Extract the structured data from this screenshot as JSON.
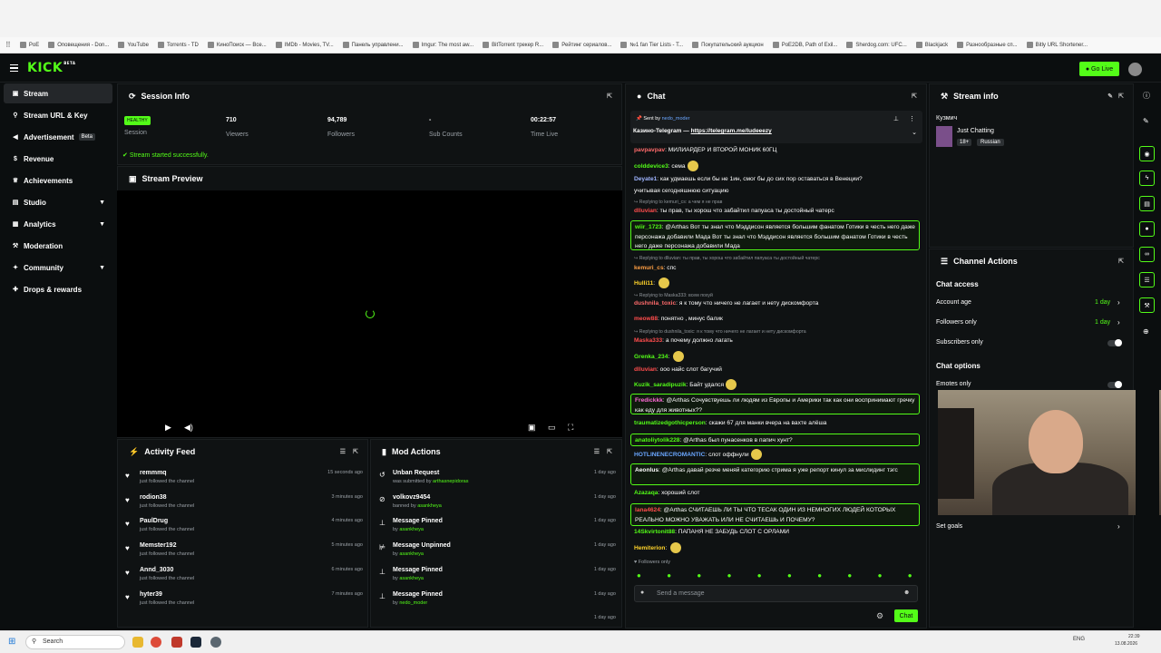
{
  "bookmarks": [
    "PoE",
    "Оповещения - Don...",
    "YouTube",
    "Torrents - TD",
    "КиноПоиск — Все...",
    "IMDb - Movies, TV...",
    "Панель управлени...",
    "Imgur: The most aw...",
    "BitTorrent трекер R...",
    "Рейтинг сериалов...",
    "№1 fan Tier Lists - T...",
    "Покупательский аукцион",
    "PoE2DB, Path of Exil...",
    "Sherdog.com: UFC...",
    "Blackjack",
    "Разнообразные сп...",
    "Bitly URL Shortener..."
  ],
  "app": {
    "logo": "KICK",
    "logo_beta": "BETA",
    "go_live": "Go Live"
  },
  "sidebar": [
    {
      "label": "Stream",
      "icon": "stream-icon"
    },
    {
      "label": "Stream URL & Key",
      "icon": "key-icon"
    },
    {
      "label": "Advertisement",
      "icon": "megaphone-icon",
      "badge": "Beta"
    },
    {
      "label": "Revenue",
      "icon": "dollar-icon"
    },
    {
      "label": "Achievements",
      "icon": "trophy-icon"
    },
    {
      "label": "Studio",
      "icon": "studio-icon"
    },
    {
      "label": "Analytics",
      "icon": "chart-icon"
    },
    {
      "label": "Moderation",
      "icon": "hammer-icon"
    },
    {
      "label": "Community",
      "icon": "community-icon"
    },
    {
      "label": "Drops & rewards",
      "icon": "gift-icon"
    }
  ],
  "session": {
    "title": "Session Info",
    "health": "HEALTHY",
    "health_label": "Session",
    "stats": [
      {
        "value": "710",
        "label": "Viewers"
      },
      {
        "value": "94,789",
        "label": "Followers"
      },
      {
        "value": "-",
        "label": "Sub Counts"
      },
      {
        "value": "00:22:57",
        "label": "Time Live"
      }
    ],
    "success": "Stream started successfully."
  },
  "preview": {
    "title": "Stream Preview"
  },
  "activity": {
    "title": "Activity Feed",
    "items": [
      {
        "name": "remmmq",
        "sub": "just followed the channel",
        "time": "15 seconds ago"
      },
      {
        "name": "rodion38",
        "sub": "just followed the channel",
        "time": "3 minutes ago"
      },
      {
        "name": "PaulDrug",
        "sub": "just followed the channel",
        "time": "4 minutes ago"
      },
      {
        "name": "Memster192",
        "sub": "just followed the channel",
        "time": "5 minutes ago"
      },
      {
        "name": "Annd_3030",
        "sub": "just followed the channel",
        "time": "6 minutes ago"
      },
      {
        "name": "hyter39",
        "sub": "just followed the channel",
        "time": "7 minutes ago"
      }
    ]
  },
  "mod": {
    "title": "Mod Actions",
    "items": [
      {
        "action": "Unban Request",
        "prefix": "was submitted by ",
        "user": "arthasnepidoras",
        "time": "1 day ago"
      },
      {
        "action": "volkovz9454",
        "prefix": "banned by ",
        "user": "asankheya",
        "time": "1 day ago"
      },
      {
        "action": "Message Pinned",
        "prefix": "by ",
        "user": "asankheya",
        "time": "1 day ago"
      },
      {
        "action": "Message Unpinned",
        "prefix": "by ",
        "user": "asankheya",
        "time": "1 day ago"
      },
      {
        "action": "Message Pinned",
        "prefix": "by ",
        "user": "asankheya",
        "time": "1 day ago"
      },
      {
        "action": "Message Pinned",
        "prefix": "by ",
        "user": "nedo_moder",
        "time": "1 day ago"
      },
      {
        "time": "1 day ago"
      }
    ]
  },
  "chat": {
    "title": "Chat",
    "pinned": {
      "sent_by": "Sent by",
      "user": "nedo_moder",
      "text": "Казино-Telegram — ",
      "link": "https://telegram.me/ludeeezy"
    },
    "messages": [
      {
        "user": "pavpavpav",
        "color": "#ff6b6b",
        "text": "МИЛИАРДЕР И ВТОРОЙ МОНИК 60ГЦ"
      },
      {
        "user": "colddevice3",
        "color": "#53fc18",
        "text": "сема"
      },
      {
        "user": "Deyate1",
        "color": "#9fb4ff",
        "text": "как удмаешь если бы не 1ин, смог бы до сих пор оставаться в Венеции?"
      },
      {
        "text": "учитывая сегодняшнюю ситуацию"
      },
      {
        "reply": "Replying to kemuri_cs: а чем я не прав"
      },
      {
        "user": "dlluvian",
        "color": "#ff4d4d",
        "text": "ты прав, ты хорош что забайтил папуаса ты достойный чатерс"
      },
      {
        "user": "wiir_1723",
        "color": "#53fc18",
        "text": "@Arthas Вот ты знал что Мэддисон является большим фанатом Готики в честь него даже персонажа добавили Мада Вот ты знал что Мэддисон является большим фанатом Готики в честь него даже персонажа добавили Мада"
      },
      {
        "reply": "Replying to dlluvian: ты прав, ты хорош что забайтил папуаса ты достойный чатерс"
      },
      {
        "user": "kemuri_cs",
        "color": "#ff9f43",
        "text": "спс"
      },
      {
        "user": "Hulli11",
        "color": "#ffd32a",
        "text": ""
      },
      {
        "reply": "Replying to Maska333: всем похуй"
      },
      {
        "user": "dushnila_toxic",
        "color": "#ff6b6b",
        "text": "я к тому что ничего не лагает и нету дискомфорта"
      },
      {
        "user": "meow88",
        "color": "#ff4d4d",
        "text": "понятно , минус балик"
      },
      {
        "reply": "Replying to dushnila_toxic: я к тому что ничего не лагает и нету дискомфорта"
      },
      {
        "user": "Maska333",
        "color": "#ff4d4d",
        "text": "а почему должно лагать"
      },
      {
        "user": "Grenka_234",
        "color": "#53fc18",
        "text": ""
      },
      {
        "user": "dlluvian",
        "color": "#ff4d4d",
        "text": "ооо найс слот багучий"
      },
      {
        "user": "Kuzik_saradipuzik",
        "color": "#53fc18",
        "text": "Байт удался"
      },
      {
        "user": "Fredickkk",
        "color": "#ff6bd6",
        "text": "@Arthas Сочувствуешь ли людям из Европы и Америки так как они воспринимают гречку как еду для животных??"
      },
      {
        "user": "traumatizedgothicperson",
        "color": "#53fc18",
        "text": "скажи 67 для манки вчера на вахте алёша"
      },
      {
        "user": "anatoliytolik228",
        "color": "#53fc18",
        "text": "@Arthas был пунасенков в папич хунт?"
      },
      {
        "user": "HOTLINENECROMANTIC",
        "color": "#6aa6ff",
        "text": "слот оффнули"
      },
      {
        "user": "Aeonlus",
        "color": "#ffffff",
        "text": "@Arthas давай резче меняй категорию стрима я уже репорт кинул за мислидинг тэгс"
      },
      {
        "user": "Azazaqa",
        "color": "#53fc18",
        "text": "хороший слот"
      },
      {
        "user": "lana4624",
        "color": "#ff4d4d",
        "text": "@Arthas СЧИТАЕШЬ ЛИ ТЫ ЧТО ТЕСАК ОДИН ИЗ НЕМНОГИХ ЛЮДЕЙ КОТОРЫХ РЕАЛЬНО МОЖНО УВАЖАТЬ ИЛИ НЕ СЧИТАЕШЬ И ПОЧЕМУ?"
      },
      {
        "user": "14Skvirtonit88",
        "color": "#53fc18",
        "text": "ПАПАНЯ НЕ ЗАБУДЬ СЛОТ С ОРЛАМИ"
      },
      {
        "user": "Hemiterion",
        "color": "#ffd32a",
        "text": ""
      }
    ],
    "followers_only": "Followers only",
    "placeholder": "Send a message",
    "send": "Chat"
  },
  "stream_info": {
    "title": "Stream info",
    "channel": "Кузмич",
    "category": "Just Chatting",
    "age": "18+",
    "language": "Russian"
  },
  "channel_actions": {
    "title": "Channel Actions",
    "chat_access": "Chat access",
    "account_age": {
      "label": "Account age",
      "value": "1 day"
    },
    "followers_only": {
      "label": "Followers only",
      "value": "1 day"
    },
    "subscribers_only": "Subscribers only",
    "chat_options": "Chat options",
    "emotes_only": "Emotes only",
    "set_goals": "Set goals"
  },
  "taskbar": {
    "search": "Search",
    "lang": "ENG",
    "time": "22:39",
    "date": "13.08.2026"
  }
}
